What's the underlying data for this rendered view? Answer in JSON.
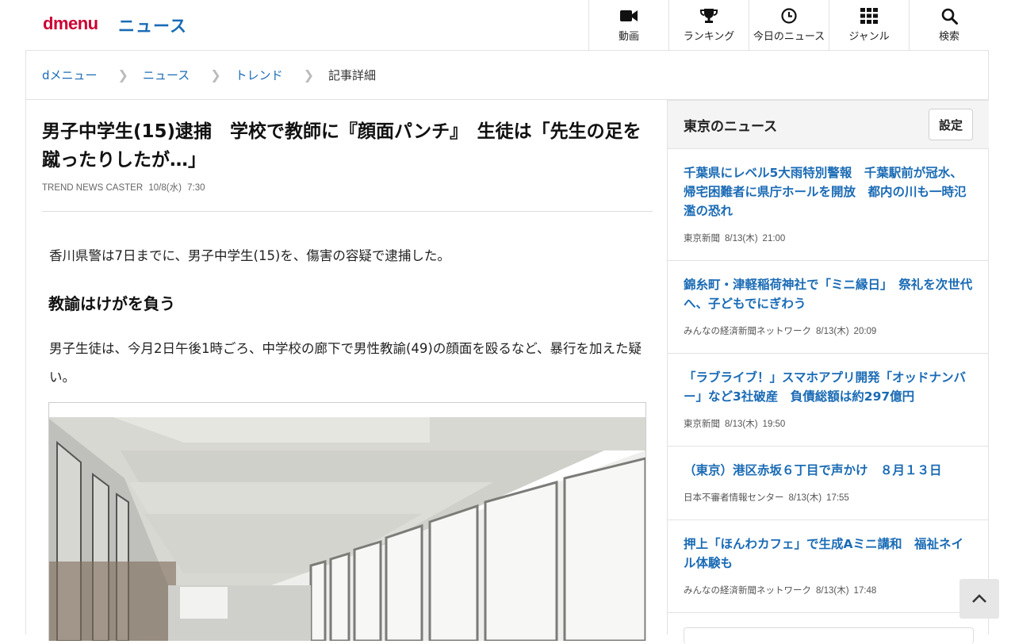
{
  "header": {
    "logo": "dmenu",
    "section_title": "ニュース",
    "nav": [
      {
        "label": "動画",
        "icon": "video-camera-icon"
      },
      {
        "label": "ランキング",
        "icon": "trophy-icon"
      },
      {
        "label": "今日のニュース",
        "icon": "clock-icon"
      },
      {
        "label": "ジャンル",
        "icon": "grid-icon"
      },
      {
        "label": "検索",
        "icon": "search-icon"
      }
    ]
  },
  "breadcrumb": [
    "dメニュー",
    "ニュース",
    "トレンド",
    "記事詳細"
  ],
  "article": {
    "title": "男子中学生(15)逮捕　学校で教師に『顔面パンチ』　生徒は「先生の足を蹴ったりしたが…」",
    "source": "TREND NEWS CASTER",
    "date": "10/8(水)",
    "time": "7:30",
    "lead": "香川県警は7日までに、男子中学生(15)を、傷害の容疑で逮捕した。",
    "subhead": "教諭はけがを負う",
    "paragraph": "男子生徒は、今月2日午後1時ごろ、中学校の廊下で男性教諭(49)の顔面を殴るなど、暴行を加えた疑い。"
  },
  "sidebar": {
    "title": "東京のニュース",
    "settings_label": "設定",
    "items": [
      {
        "title": "千葉県にレベル5大雨特別警報　千葉駅前が冠水、帰宅困難者に県庁ホールを開放　都内の川も一時氾濫の恐れ",
        "source": "東京新聞",
        "date": "8/13(木)",
        "time": "21:00"
      },
      {
        "title": "錦糸町・津軽稲荷神社で「ミニ縁日」　祭礼を次世代へ、子どもでにぎわう",
        "source": "みんなの経済新聞ネットワーク",
        "date": "8/13(木)",
        "time": "20:09"
      },
      {
        "title": "「ラブライブ！」スマホアプリ開発「オッドナンバー」など3社破産　負債総額は約297億円",
        "source": "東京新聞",
        "date": "8/13(木)",
        "time": "19:50"
      },
      {
        "title": "（東京）港区赤坂６丁目で声かけ　８月１３日",
        "source": "日本不審者情報センター",
        "date": "8/13(木)",
        "time": "17:55"
      },
      {
        "title": "押上「ほんわカフェ」で生成Aミニ講和　福祉ネイル体験も",
        "source": "みんなの経済新聞ネットワーク",
        "date": "8/13(木)",
        "time": "17:48"
      }
    ]
  },
  "colors": {
    "brand_red": "#cc0033",
    "link_blue": "#1a6bb5"
  }
}
